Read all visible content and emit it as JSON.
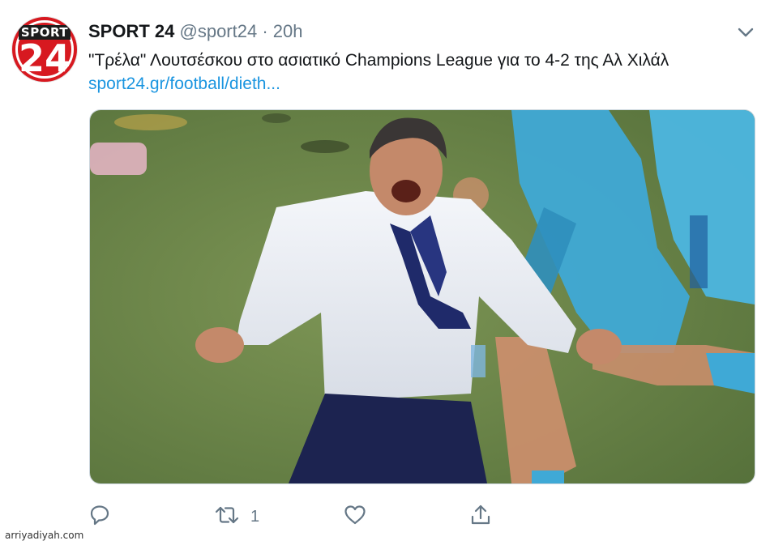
{
  "tweet": {
    "account_name": "SPORT 24",
    "handle": "@sport24",
    "separator": "·",
    "time": "20h",
    "text": "\"Τρέλα\" Λουτσέσκου στο ασιατικό Champions League για το 4-2 της Αλ Χιλάλ ",
    "link": "sport24.gr/football/dieth...",
    "avatar": {
      "top_text": "SPORT",
      "number": "24",
      "color": "#d71920"
    },
    "actions": {
      "reply_icon": "reply-icon",
      "retweet_icon": "retweet-icon",
      "retweet_count": "1",
      "like_icon": "heart-icon",
      "share_icon": "share-icon"
    },
    "menu_icon": "chevron-down-icon"
  },
  "watermark": "arriyadiyah.com",
  "colors": {
    "link": "#1b95e0",
    "secondary": "#657786",
    "pitch": "#6f8a4c",
    "kit": "#3fa9d6"
  }
}
